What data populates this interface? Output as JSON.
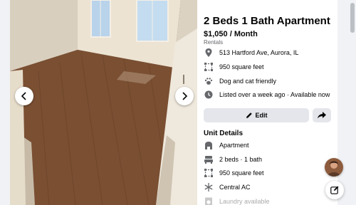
{
  "listing": {
    "title": "2 Beds 1 Bath Apartment",
    "price": "$1,050 / Month",
    "category": "Rentals",
    "address": "513 Hartford Ave, Aurora, IL",
    "size": "950 square feet",
    "pets": "Dog and cat friendly",
    "listed": "Listed over a week ago · Available now"
  },
  "actions": {
    "edit_label": "Edit"
  },
  "unit_details": {
    "heading": "Unit Details",
    "type": "Apartment",
    "beds_baths": "2 beds · 1 bath",
    "size": "950 square feet",
    "ac": "Central AC",
    "laundry": "Laundry available"
  },
  "icons": {
    "prev": "chevron-left-icon",
    "next": "chevron-right-icon",
    "location": "location-pin-icon",
    "size": "square-footage-icon",
    "pets": "paw-icon",
    "clock": "clock-icon",
    "edit": "pencil-icon",
    "share": "share-arrow-icon",
    "apartment": "building-icon",
    "bed": "bed-icon",
    "ac": "snowflake-icon",
    "compose": "compose-icon"
  },
  "colors": {
    "background": "#f0f2f5",
    "button": "#e4e6eb",
    "secondary_text": "#65676b",
    "icon": "#65676b"
  }
}
